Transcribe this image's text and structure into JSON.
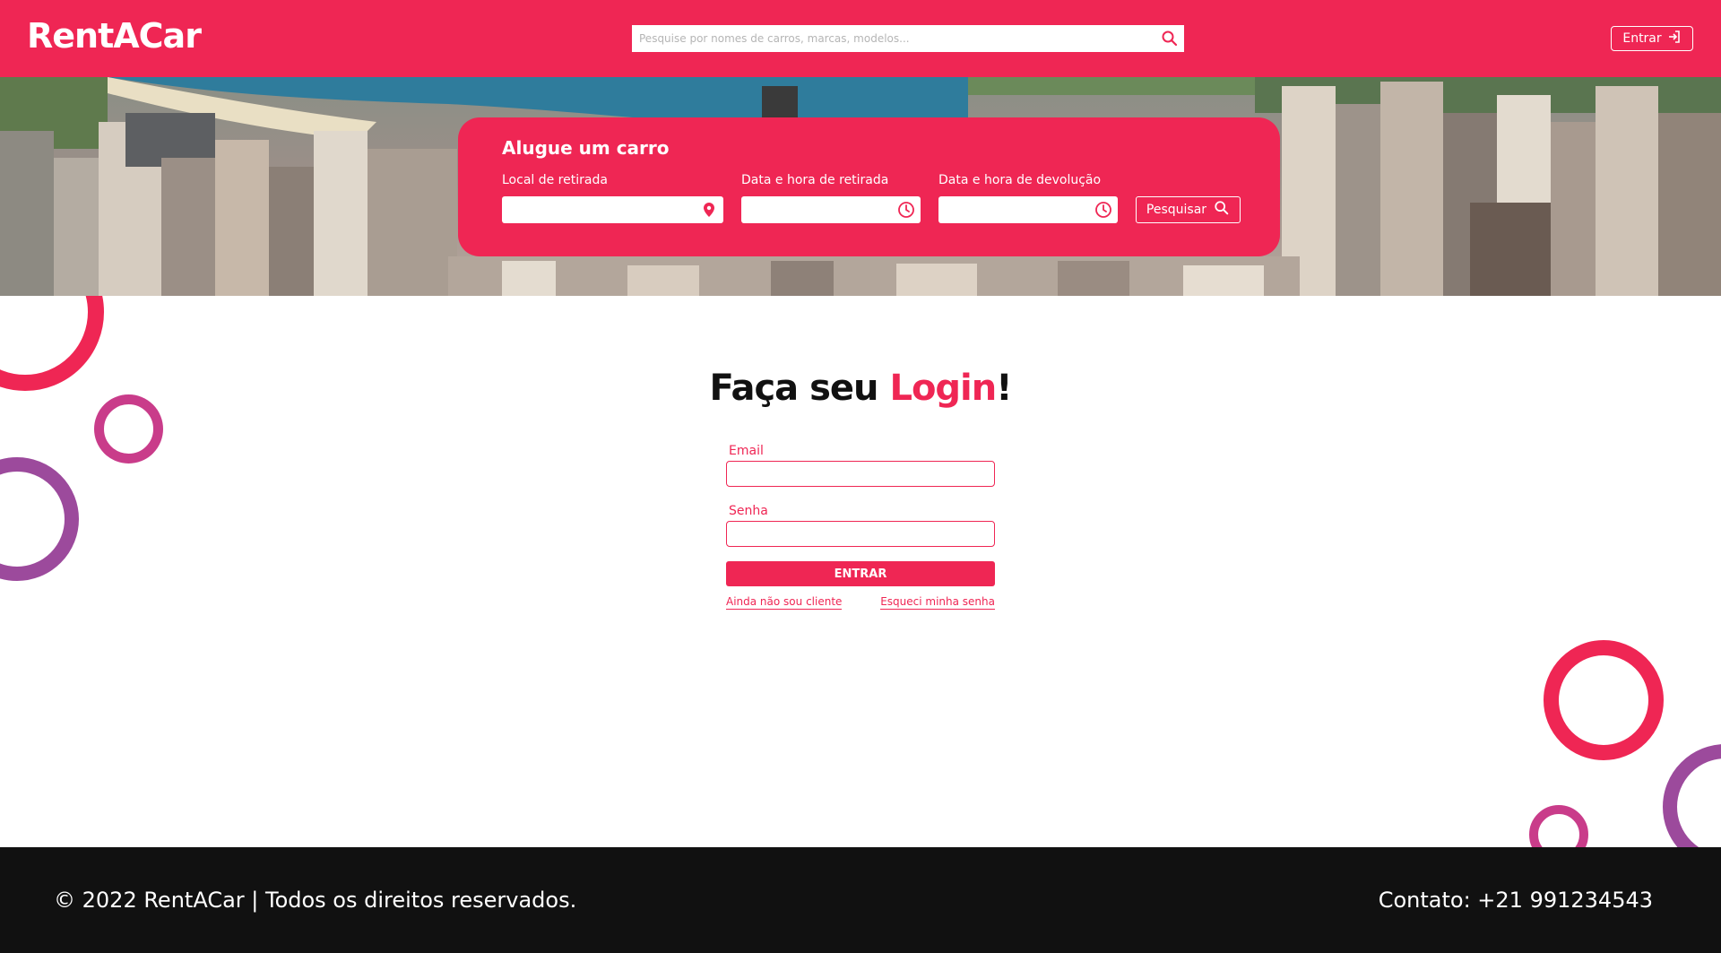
{
  "header": {
    "logo": "RentACar",
    "search_placeholder": "Pesquise por nomes de carros, marcas, modelos...",
    "login_label": "Entrar"
  },
  "rent_card": {
    "title": "Alugue um carro",
    "pickup_location_label": "Local de retirada",
    "pickup_datetime_label": "Data e hora de retirada",
    "return_datetime_label": "Data e hora de devolução",
    "search_label": "Pesquisar"
  },
  "login": {
    "title_prefix": "Faça seu ",
    "title_highlight": "Login",
    "title_suffix": "!",
    "email_label": "Email",
    "password_label": "Senha",
    "submit_label": "ENTRAR",
    "signup_link": "Ainda não sou cliente",
    "forgot_link": "Esqueci minha senha"
  },
  "footer": {
    "copyright": "© 2022 RentACar | Todos os direitos reservados.",
    "contact": "Contato:  +21 991234543"
  },
  "colors": {
    "accent": "#ef2654",
    "footer_bg": "#111111",
    "ring_purple": "#9c4a9c",
    "ring_magenta": "#c93c8a"
  }
}
